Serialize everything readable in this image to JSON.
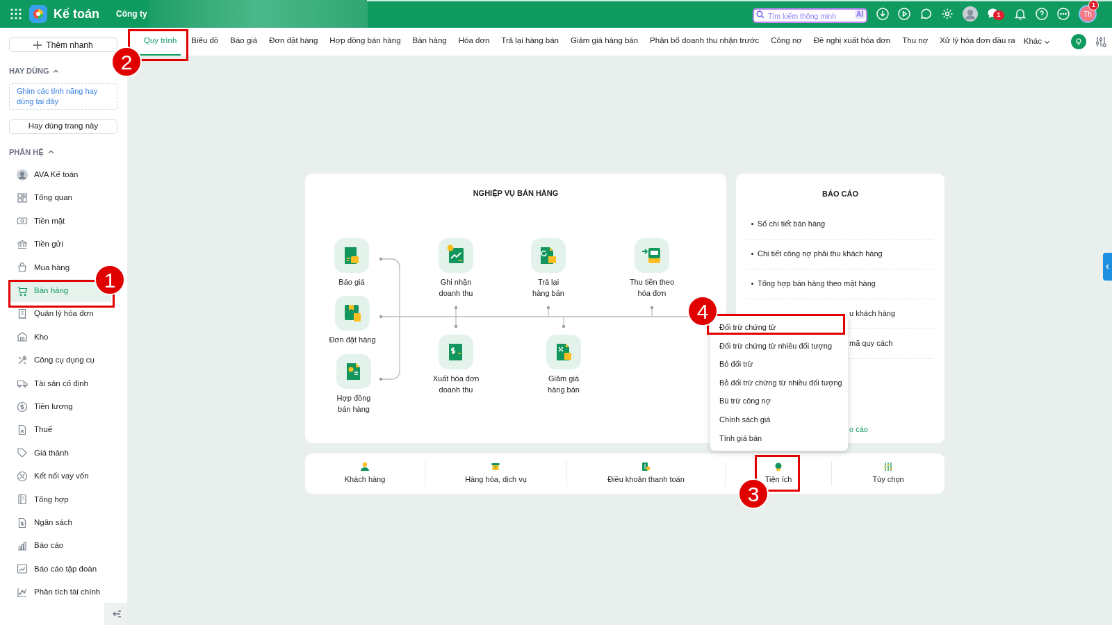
{
  "header": {
    "app_title": "Kế toán",
    "company": "Công ty",
    "search": {
      "placeholder": "Tìm kiếm thông minh",
      "badge": "AI"
    },
    "chat_badge": "1",
    "user_initials": "Th",
    "user_badge": "1"
  },
  "sidebar": {
    "quick_add": "Thêm nhanh",
    "favorites": {
      "heading": "HAY DÙNG",
      "expanded": true,
      "hint": "Ghim các tính năng hay dùng tại đây",
      "button": "Hay dùng trang này"
    },
    "modules": {
      "heading": "PHÂN HỆ",
      "expanded": true,
      "items": [
        {
          "label": "AVA Kế toán",
          "selected": false
        },
        {
          "label": "Tổng quan",
          "selected": false
        },
        {
          "label": "Tiền mặt",
          "selected": false
        },
        {
          "label": "Tiền gửi",
          "selected": false
        },
        {
          "label": "Mua hàng",
          "selected": false
        },
        {
          "label": "Bán hàng",
          "selected": true
        },
        {
          "label": "Quản lý hóa đơn",
          "selected": false
        },
        {
          "label": "Kho",
          "selected": false
        },
        {
          "label": "Công cụ dụng cụ",
          "selected": false
        },
        {
          "label": "Tài sản cố định",
          "selected": false
        },
        {
          "label": "Tiền lương",
          "selected": false
        },
        {
          "label": "Thuế",
          "selected": false
        },
        {
          "label": "Giá thành",
          "selected": false
        },
        {
          "label": "Kết nối vay vốn",
          "selected": false
        },
        {
          "label": "Tổng hợp",
          "selected": false
        },
        {
          "label": "Ngân sách",
          "selected": false
        },
        {
          "label": "Báo cáo",
          "selected": false
        },
        {
          "label": "Báo cáo tập đoàn",
          "selected": false
        },
        {
          "label": "Phân tích tài chính",
          "selected": false
        }
      ]
    }
  },
  "tabs": [
    {
      "label": "Quy trình",
      "selected": true
    },
    {
      "label": "Biểu đồ",
      "selected": false
    },
    {
      "label": "Báo giá",
      "selected": false
    },
    {
      "label": "Đơn đặt hàng",
      "selected": false
    },
    {
      "label": "Hợp đồng bán hàng",
      "selected": false
    },
    {
      "label": "Bán hàng",
      "selected": false
    },
    {
      "label": "Hóa đơn",
      "selected": false
    },
    {
      "label": "Trả lại hàng bán",
      "selected": false
    },
    {
      "label": "Giảm giá hàng bán",
      "selected": false
    },
    {
      "label": "Phân bổ doanh thu nhận trước",
      "selected": false
    },
    {
      "label": "Công nợ",
      "selected": false
    },
    {
      "label": "Đề nghị xuất hóa đơn",
      "selected": false
    },
    {
      "label": "Thu nợ",
      "selected": false
    },
    {
      "label": "Xử lý hóa đơn đầu ra",
      "selected": false
    }
  ],
  "more_tab": "Khác",
  "process": {
    "title": "NGHIỆP VỤ BÁN HÀNG",
    "nodes": [
      {
        "label": "Báo giá"
      },
      {
        "label": "Đơn đặt hàng"
      },
      {
        "label": "Hợp đồng\nbán hàng"
      },
      {
        "label": "Ghi nhận\ndoanh thu"
      },
      {
        "label": "Trả lại\nhàng bán"
      },
      {
        "label": "Thu tiền theo\nhóa đơn"
      },
      {
        "label": "Xuất hóa đơn\ndoanh thu"
      },
      {
        "label": "Giảm giá\nhàng bán"
      }
    ]
  },
  "reports": {
    "title": "BÁO CÁO",
    "items": [
      {
        "text": "Sổ chi tiết bán hàng",
        "kind": "full"
      },
      {
        "text": "Chi tiết công nợ phải thu khách hàng",
        "kind": "full"
      },
      {
        "text": "Tổng hợp bán hàng theo mặt hàng",
        "kind": "full"
      },
      {
        "text": "u khách hàng",
        "kind": "cut"
      },
      {
        "text": "mã quy cách",
        "kind": "cut"
      }
    ],
    "link": "o cáo"
  },
  "bottom_bar": [
    {
      "label": "Khách hàng"
    },
    {
      "label": "Hàng hóa, dịch vụ"
    },
    {
      "label": "Điều khoản thanh toán"
    },
    {
      "label": "Tiện ích"
    },
    {
      "label": "Tùy chọn"
    }
  ],
  "menu": {
    "items": [
      "Đối trừ chứng từ",
      "Đối trừ chứng từ nhiều đối tượng",
      "Bỏ đối trừ",
      "Bỏ đối trừ chứng từ nhiều đối tượng",
      "Bù trừ công nợ",
      "Chính sách giá",
      "Tính giá bán"
    ]
  },
  "annotations": [
    {
      "label": "1"
    },
    {
      "label": "2"
    },
    {
      "label": "3"
    },
    {
      "label": "4"
    }
  ]
}
